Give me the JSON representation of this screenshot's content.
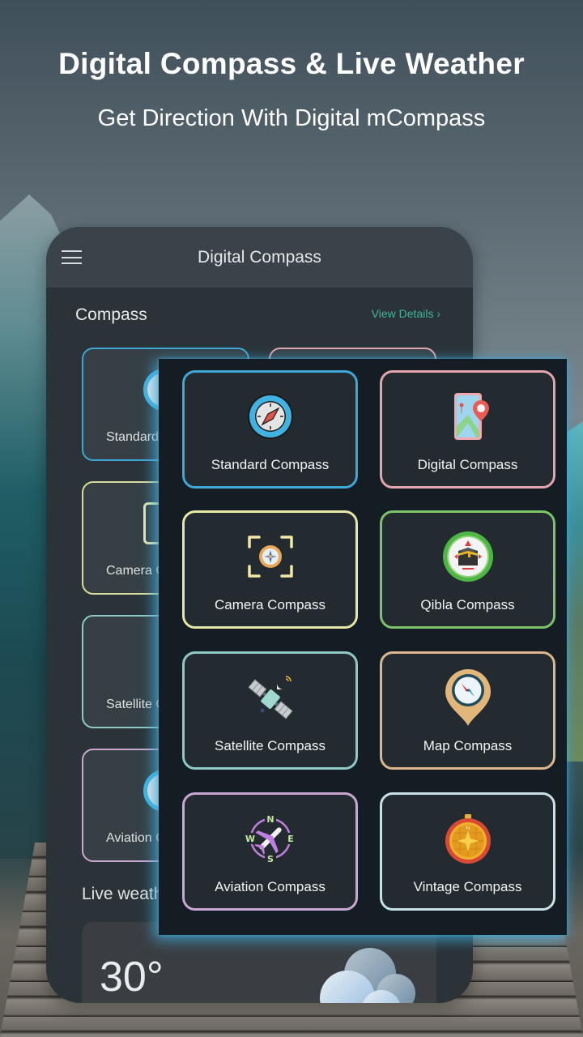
{
  "hero": {
    "title": "Digital Compass & Live Weather",
    "subtitle": "Get Direction With Digital mCompass"
  },
  "phone": {
    "app_title": "Digital Compass",
    "menu_icon": "hamburger-menu-icon",
    "section_title": "Compass",
    "view_details": "View Details ›",
    "background_cards": [
      {
        "label": "Standard Compass",
        "border_color": "#3ea7d6"
      },
      {
        "label": "Digital Compass",
        "border_color": "#e3a4ae"
      },
      {
        "label": "Camera Compass",
        "border_color": "#d9dc9a"
      },
      {
        "label": "Qibla Compass",
        "border_color": "#7cc36a"
      },
      {
        "label": "Satellite Compass",
        "border_color": "#8ec9c6"
      },
      {
        "label": "Map Compass",
        "border_color": "#dcb78d"
      },
      {
        "label": "Aviation Compass",
        "border_color": "#c8a8d2"
      },
      {
        "label": "Vintage Compass",
        "border_color": "#c8e0e6"
      }
    ],
    "weather_label": "Live weather",
    "temperature": "30°",
    "weather_icon": "cloud-icon"
  },
  "panel": {
    "cards": [
      {
        "label": "Standard Compass",
        "icon": "compass-icon",
        "border_color": "#3ea7d6"
      },
      {
        "label": "Digital Compass",
        "icon": "phone-map-pin-icon",
        "border_color": "#e3a4ae"
      },
      {
        "label": "Camera Compass",
        "icon": "camera-compass-icon",
        "border_color": "#e6e7a6"
      },
      {
        "label": "Qibla Compass",
        "icon": "kaaba-compass-icon",
        "border_color": "#7cc36a"
      },
      {
        "label": "Satellite Compass",
        "icon": "satellite-icon",
        "border_color": "#8ec9c6"
      },
      {
        "label": "Map Compass",
        "icon": "map-pin-compass-icon",
        "border_color": "#dcb78d"
      },
      {
        "label": "Aviation Compass",
        "icon": "airplane-compass-icon",
        "border_color": "#c8a8d2"
      },
      {
        "label": "Vintage Compass",
        "icon": "vintage-compass-icon",
        "border_color": "#c8e0e6"
      }
    ]
  },
  "colors": {
    "accent_green": "#3fb597",
    "panel_glow": "#40aadc"
  }
}
